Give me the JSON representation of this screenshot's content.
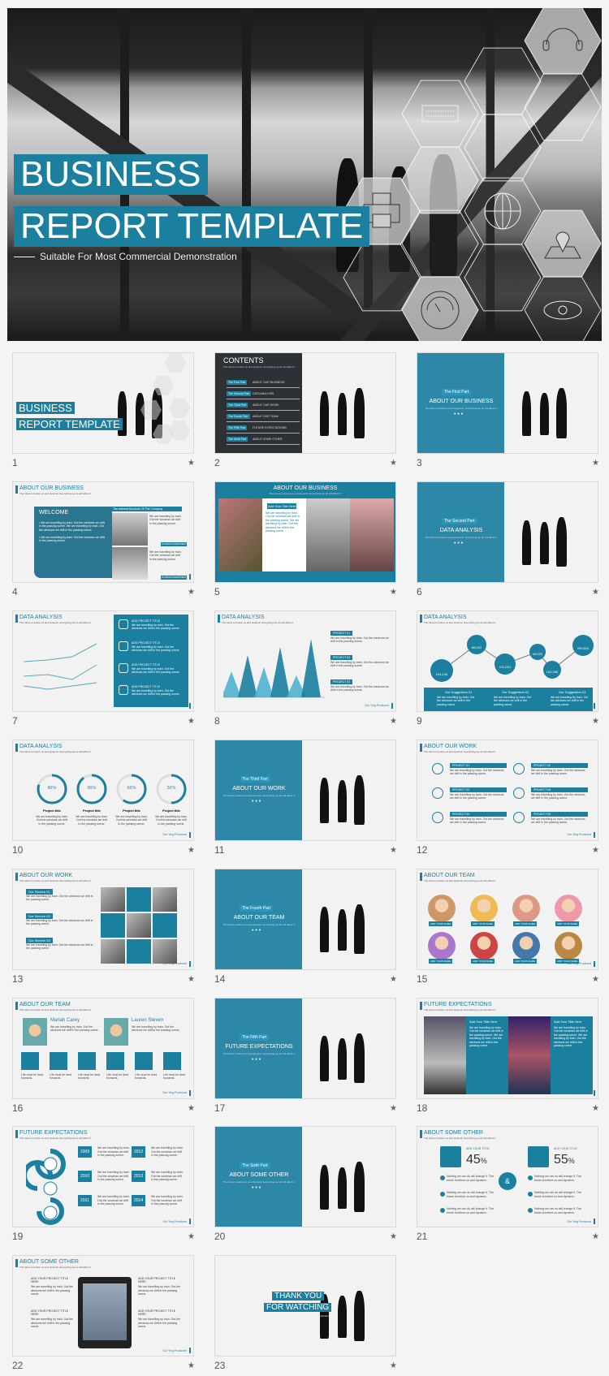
{
  "hero": {
    "title_line1": "BUSINESS",
    "title_line2": "REPORT TEMPLATE",
    "subtitle": "Suitable For Most Commercial Demonstration",
    "hex_icons": [
      "headphones-icon",
      "keyboard-icon",
      "printer-icon",
      "globe-icon",
      "map-pin-icon",
      "gauge-icon",
      "eye-icon"
    ]
  },
  "accent": "#1b7fa0",
  "subtitle_text": "The future is before us and dynamic. Everything we do will affect it.",
  "footer_text": "Our Ying Produced",
  "slides": [
    {
      "n": "1",
      "type": "cover",
      "l1": "BUSINESS",
      "l2": "REPORT TEMPLATE"
    },
    {
      "n": "2",
      "type": "contents",
      "title": "CONTENTS",
      "items": [
        [
          "The First Part",
          "ABOUT OUR BUSINESS"
        ],
        [
          "The Second Part",
          "DATA ANALYSIS"
        ],
        [
          "The Third Part",
          "ABOUT OUR WORK"
        ],
        [
          "The Fourth Part",
          "ABOUT OUR TEAM"
        ],
        [
          "The Fifth Part",
          "FUTURE EXPECTATIONS"
        ],
        [
          "The Sixth Part",
          "ABOUT SOME OTHER"
        ]
      ]
    },
    {
      "n": "3",
      "type": "section",
      "part": "The First Part",
      "title": "ABOUT OUR BUSINESS"
    },
    {
      "n": "4",
      "type": "business",
      "title": "ABOUT OUR BUSINESS",
      "welcome": "WELCOME",
      "box": "The Internal Structure Of The Company",
      "btn": "PLANNING DEPARTMENT"
    },
    {
      "n": "5",
      "type": "business2",
      "title": "ABOUT OUR BUSINESS",
      "card": "Add Your Title Here"
    },
    {
      "n": "6",
      "type": "section",
      "part": "The Second Part",
      "title": "DATA ANALYSIS"
    },
    {
      "n": "7",
      "type": "linechart",
      "title": "DATA ANALYSIS",
      "items": [
        "ADD PROJECT TITLE",
        "ADD PROJECT TITLE",
        "ADD PROJECT TITLE",
        "ADD PROJECT TITLE"
      ]
    },
    {
      "n": "8",
      "type": "triangles",
      "title": "DATA ANALYSIS",
      "items": [
        "PROJECT 01",
        "PROJECT 02",
        "PROJECT 03"
      ]
    },
    {
      "n": "9",
      "type": "bubbles",
      "title": "DATA ANALYSIS",
      "values": [
        "224,130",
        "66,002",
        "101,021",
        "40,020",
        "131,260",
        "200,810"
      ],
      "suggestions": [
        "Our Suggestion 01",
        "Our Suggestion 02",
        "Our Suggestion 03"
      ]
    },
    {
      "n": "10",
      "type": "rings",
      "title": "DATA ANALYSIS",
      "rings": [
        {
          "label": "80%",
          "value": 80
        },
        {
          "label": "90%",
          "value": 90
        },
        {
          "label": "60%",
          "value": 60
        },
        {
          "label": "50%",
          "value": 50
        }
      ],
      "ptitle": "Project title"
    },
    {
      "n": "11",
      "type": "section",
      "part": "The Third Part",
      "title": "ABOUT OUR WORK"
    },
    {
      "n": "12",
      "type": "work",
      "title": "ABOUT OUR WORK",
      "items": [
        "PROJECT 01",
        "PROJECT 02",
        "PROJECT 03",
        "PROJECT 04",
        "PROJECT 05",
        "PROJECT 06"
      ]
    },
    {
      "n": "13",
      "type": "services",
      "title": "ABOUT OUR WORK",
      "items": [
        "Our Service 01",
        "Our Service 02",
        "Our Service 03"
      ]
    },
    {
      "n": "14",
      "type": "section",
      "part": "The Fourth Part",
      "title": "ABOUT OUR TEAM"
    },
    {
      "n": "15",
      "type": "team",
      "title": "ABOUT OUR TEAM",
      "name": "ADD YOUR NAME"
    },
    {
      "n": "16",
      "type": "team2",
      "title": "ABOUT OUR TEAM",
      "names": [
        "Mariah Carey",
        "Lauren Steven"
      ]
    },
    {
      "n": "17",
      "type": "section",
      "part": "The Fifth Part",
      "title": "FUTURE EXPECTATIONS"
    },
    {
      "n": "18",
      "type": "future",
      "title": "FUTURE EXPECTATIONS",
      "card": "Add Your Title Here"
    },
    {
      "n": "19",
      "type": "timeline",
      "title": "FUTURE EXPECTATIONS",
      "years": [
        "2009",
        "2010",
        "2011",
        "2012",
        "2013",
        "2014"
      ]
    },
    {
      "n": "20",
      "type": "section",
      "part": "The Sixth Part",
      "title": "ABOUT SOME OTHER"
    },
    {
      "n": "21",
      "type": "percent",
      "title": "ABOUT SOME OTHER",
      "ptitle": "ADD YOUR TITLE",
      "p1": "45",
      "p2": "55",
      "amp": "&"
    },
    {
      "n": "22",
      "type": "tablet",
      "title": "ABOUT SOME OTHER",
      "items": [
        "ADD YOUR PROJECT TITLE HERE",
        "ADD YOUR PROJECT TITLE HERE",
        "ADD YOUR PROJECT TITLE HERE",
        "ADD YOUR PROJECT TITLE HERE"
      ]
    },
    {
      "n": "23",
      "type": "thanks",
      "l1": "THANK YOU",
      "l2": "FOR WATCHING"
    }
  ]
}
